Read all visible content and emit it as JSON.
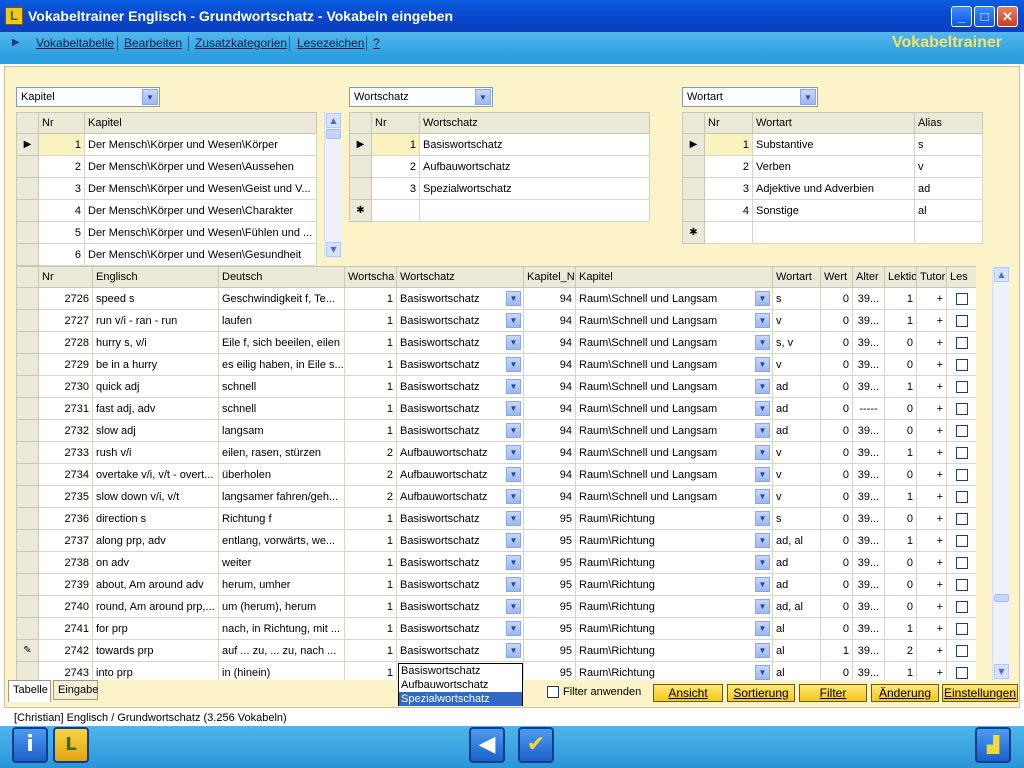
{
  "window": {
    "title": "Vokabeltrainer Englisch - Grundwortschatz - Vokabeln eingeben",
    "app_icon_letter": "L"
  },
  "menu": {
    "items": [
      "Vokabeltabelle",
      "Bearbeiten",
      "Zusatzkategorien",
      "Lesezeichen",
      "?"
    ],
    "brand": "Vokabeltrainer"
  },
  "kapitel": {
    "combo": "Kapitel",
    "headers": [
      "Nr",
      "Kapitel"
    ],
    "rows": [
      {
        "nr": "1",
        "name": "Der Mensch\\Körper und Wesen\\Körper"
      },
      {
        "nr": "2",
        "name": "Der Mensch\\Körper und Wesen\\Aussehen"
      },
      {
        "nr": "3",
        "name": "Der Mensch\\Körper und Wesen\\Geist und V..."
      },
      {
        "nr": "4",
        "name": "Der Mensch\\Körper und Wesen\\Charakter"
      },
      {
        "nr": "5",
        "name": "Der Mensch\\Körper und Wesen\\Fühlen und ..."
      },
      {
        "nr": "6",
        "name": "Der Mensch\\Körper und Wesen\\Gesundheit"
      }
    ]
  },
  "wortschatz": {
    "combo": "Wortschatz",
    "headers": [
      "Nr",
      "Wortschatz"
    ],
    "rows": [
      {
        "nr": "1",
        "name": "Basiswortschatz"
      },
      {
        "nr": "2",
        "name": "Aufbauwortschatz"
      },
      {
        "nr": "3",
        "name": "Spezialwortschatz"
      }
    ],
    "newrow": "✱"
  },
  "wortart": {
    "combo": "Wortart",
    "headers": [
      "Nr",
      "Wortart",
      "Alias"
    ],
    "rows": [
      {
        "nr": "1",
        "name": "Substantive",
        "alias": "s"
      },
      {
        "nr": "2",
        "name": "Verben",
        "alias": "v"
      },
      {
        "nr": "3",
        "name": "Adjektive und Adverbien",
        "alias": "ad"
      },
      {
        "nr": "4",
        "name": "Sonstige",
        "alias": "al"
      }
    ],
    "newrow": "✱"
  },
  "main": {
    "headers": [
      "Nr",
      "Englisch",
      "Deutsch",
      "Wortscha",
      "Wortschatz",
      "Kapitel_N",
      "Kapitel",
      "Wortart",
      "Wert",
      "Alter",
      "Lektio",
      "Tutor",
      "Les"
    ],
    "rows": [
      [
        "2726",
        "speed s",
        "Geschwindigkeit f, Te...",
        "1",
        "Basiswortschatz",
        "94",
        "Raum\\Schnell und Langsam",
        "s",
        "0",
        "39...",
        "1",
        "+"
      ],
      [
        "2727",
        "run v/i - ran - run",
        "laufen",
        "1",
        "Basiswortschatz",
        "94",
        "Raum\\Schnell und Langsam",
        "v",
        "0",
        "39...",
        "1",
        "+"
      ],
      [
        "2728",
        "hurry s, v/i",
        "Eile f, sich beeilen, eilen",
        "1",
        "Basiswortschatz",
        "94",
        "Raum\\Schnell und Langsam",
        "s, v",
        "0",
        "39...",
        "0",
        "+"
      ],
      [
        "2729",
        "be in a hurry",
        "es eilig haben, in Eile s...",
        "1",
        "Basiswortschatz",
        "94",
        "Raum\\Schnell und Langsam",
        "v",
        "0",
        "39...",
        "0",
        "+"
      ],
      [
        "2730",
        "quick adj",
        "schnell",
        "1",
        "Basiswortschatz",
        "94",
        "Raum\\Schnell und Langsam",
        "ad",
        "0",
        "39...",
        "1",
        "+"
      ],
      [
        "2731",
        "fast adj, adv",
        "schnell",
        "1",
        "Basiswortschatz",
        "94",
        "Raum\\Schnell und Langsam",
        "ad",
        "0",
        "-----",
        "0",
        "+"
      ],
      [
        "2732",
        "slow adj",
        "langsam",
        "1",
        "Basiswortschatz",
        "94",
        "Raum\\Schnell und Langsam",
        "ad",
        "0",
        "39...",
        "0",
        "+"
      ],
      [
        "2733",
        "rush v/i",
        "eilen, rasen, stürzen",
        "2",
        "Aufbauwortschatz",
        "94",
        "Raum\\Schnell und Langsam",
        "v",
        "0",
        "39...",
        "1",
        "+"
      ],
      [
        "2734",
        "overtake v/i, v/t - overt...",
        "überholen",
        "2",
        "Aufbauwortschatz",
        "94",
        "Raum\\Schnell und Langsam",
        "v",
        "0",
        "39...",
        "0",
        "+"
      ],
      [
        "2735",
        "slow down v/i, v/t",
        "langsamer fahren/geh...",
        "2",
        "Aufbauwortschatz",
        "94",
        "Raum\\Schnell und Langsam",
        "v",
        "0",
        "39...",
        "1",
        "+"
      ],
      [
        "2736",
        "direction s",
        "Richtung f",
        "1",
        "Basiswortschatz",
        "95",
        "Raum\\Richtung",
        "s",
        "0",
        "39...",
        "0",
        "+"
      ],
      [
        "2737",
        "along prp, adv",
        "entlang, vorwärts, we...",
        "1",
        "Basiswortschatz",
        "95",
        "Raum\\Richtung",
        "ad, al",
        "0",
        "39...",
        "1",
        "+"
      ],
      [
        "2738",
        "on adv",
        "weiter",
        "1",
        "Basiswortschatz",
        "95",
        "Raum\\Richtung",
        "ad",
        "0",
        "39...",
        "0",
        "+"
      ],
      [
        "2739",
        "about, Am around adv",
        "herum, umher",
        "1",
        "Basiswortschatz",
        "95",
        "Raum\\Richtung",
        "ad",
        "0",
        "39...",
        "0",
        "+"
      ],
      [
        "2740",
        "round, Am around prp,...",
        "um (herum), herum",
        "1",
        "Basiswortschatz",
        "95",
        "Raum\\Richtung",
        "ad, al",
        "0",
        "39...",
        "0",
        "+"
      ],
      [
        "2741",
        "for prp",
        "nach, in Richtung, mit ...",
        "1",
        "Basiswortschatz",
        "95",
        "Raum\\Richtung",
        "al",
        "0",
        "39...",
        "1",
        "+"
      ],
      [
        "2742",
        "towards prp",
        "auf ... zu, ... zu, nach ...",
        "1",
        "Basiswortschatz",
        "95",
        "Raum\\Richtung",
        "al",
        "1",
        "39...",
        "2",
        "+"
      ],
      [
        "2743",
        "into prp",
        "in (hinein)",
        "1",
        "Basiswortschatz",
        "95",
        "Raum\\Richtung",
        "al",
        "0",
        "39...",
        "1",
        "+"
      ]
    ],
    "edit_marker": "✎"
  },
  "dropdown_options": [
    "Basiswortschatz",
    "Aufbauwortschatz",
    "Spezialwortschatz"
  ],
  "tabs": [
    "Tabelle",
    "Eingabe"
  ],
  "filter_label": "Filter anwenden",
  "buttons": [
    "Ansicht",
    "Sortierung",
    "Filter",
    "Änderung",
    "Einstellungen"
  ],
  "status": "[Christian]  Englisch / Grundwortschatz  (3.256 Vokabeln)",
  "colors": {
    "accent_yellow": "#fdf3c8",
    "brand_yellow": "#f6e36a",
    "blue": "#2c9fe0"
  }
}
